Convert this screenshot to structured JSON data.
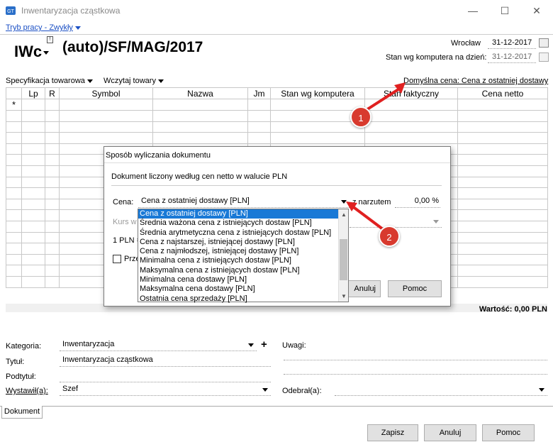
{
  "window": {
    "title": "Inwentaryzacja cząstkowa"
  },
  "mode_link": "Tryb pracy - Zwykły",
  "doc": {
    "type": "IWc",
    "number": "(auto)/SF/MAG/2017",
    "city": "Wrocław",
    "date": "31-12-2017",
    "stock_label": "Stan wg komputera na dzień:",
    "stock_date": "31-12-2017"
  },
  "toolbar": {
    "spec": "Specyfikacja towarowa",
    "load": "Wczytaj towary",
    "default_price": "Domyślna cena: Cena z ostatniej dostawy"
  },
  "grid": {
    "headers": [
      "Lp",
      "R",
      "Symbol",
      "Nazwa",
      "Jm",
      "Stan wg komputera",
      "Stan faktyczny",
      "Cena netto"
    ],
    "new_row_marker": "*"
  },
  "dialog": {
    "title": "Sposób wyliczania dokumentu",
    "info": "Dokument liczony według cen netto w walucie PLN",
    "price_label": "Cena:",
    "price_value": "Cena z ostatniej dostawy [PLN]",
    "markup_label": "z narzutem",
    "markup_value": "0,00 %",
    "rate_label": "Kurs w",
    "conversion": "1 PLN =",
    "checkbox_label": "Prze",
    "cancel": "Anuluj",
    "help": "Pomoc",
    "options": [
      "Cena z ostatniej dostawy [PLN]",
      "Średnia ważona cena z istniejących dostaw [PLN]",
      "Średnia arytmetyczna cena z istniejących dostaw [PLN]",
      "Cena z najstarszej, istniejącej dostawy [PLN]",
      "Cena z najmłodszej, istniejącej dostawy [PLN]",
      "Minimalna cena z istniejących dostaw [PLN]",
      "Maksymalna cena z istniejących dostaw [PLN]",
      "Minimalna cena dostawy [PLN]",
      "Maksymalna cena dostawy [PLN]",
      "Ostatnia cena sprzedaży [PLN]"
    ]
  },
  "value_label": "Wartość: 0,00 PLN",
  "form": {
    "category_label": "Kategoria:",
    "category_value": "Inwentaryzacja",
    "title_label": "Tytuł:",
    "title_value": "Inwentaryzacja cząstkowa",
    "subtitle_label": "Podtytuł:",
    "issued_label": "Wystawił(a):",
    "issued_value": "Szef",
    "notes_label": "Uwagi:",
    "received_label": "Odebrał(a):"
  },
  "tabs": {
    "document": "Dokument"
  },
  "buttons": {
    "save": "Zapisz",
    "cancel": "Anuluj",
    "help": "Pomoc"
  },
  "callouts": [
    "1",
    "2"
  ],
  "colors": {
    "accent": "#1a4fc4",
    "selection": "#1979d6",
    "callout": "#d83a2e"
  }
}
